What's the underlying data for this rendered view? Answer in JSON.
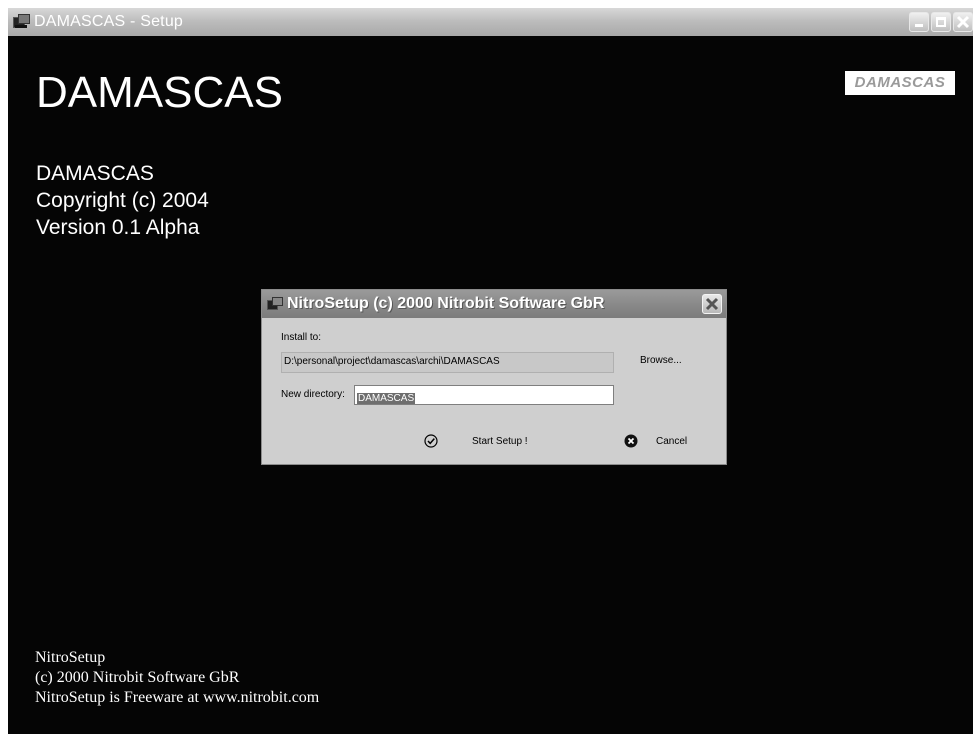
{
  "window": {
    "title": "DAMASCAS - Setup"
  },
  "main": {
    "heading": "DAMASCAS",
    "logo_text": "DAMASCAS",
    "info": [
      "DAMASCAS",
      "Copyright (c) 2004",
      "Version 0.1 Alpha"
    ],
    "footer": [
      "NitroSetup",
      "(c) 2000 Nitrobit Software GbR",
      "NitroSetup is Freeware at www.nitrobit.com"
    ]
  },
  "dialog": {
    "title": "NitroSetup (c) 2000 Nitrobit Software GbR",
    "install_to_label": "Install to:",
    "install_path": "D:\\personal\\project\\damascas\\archi\\DAMASCAS",
    "browse_label": "Browse...",
    "new_directory_label": "New directory:",
    "new_directory_value": "DAMASCAS",
    "start_label": "Start Setup !",
    "cancel_label": "Cancel"
  },
  "icons": {
    "app": "setup-computer-icon",
    "minimize": "minimize-icon",
    "maximize": "maximize-icon",
    "close": "close-icon",
    "start": "checkmark-circle-icon",
    "cancel": "x-circle-icon"
  }
}
